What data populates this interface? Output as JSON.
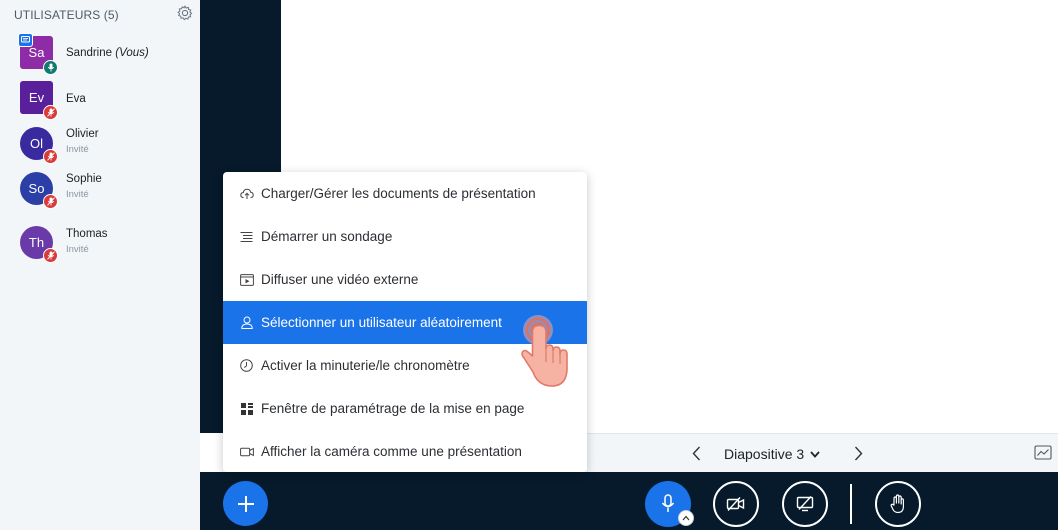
{
  "sidebar": {
    "header": "UTILISATEURS (5)",
    "gear_icon": "gear-icon",
    "users": [
      {
        "initials": "Sa",
        "name": "Sandrine",
        "suffix": "(Vous)",
        "subtitle": "",
        "color": "#8e2ca8",
        "shape": "square",
        "badge": "mic",
        "badge_color": "#12796f"
      },
      {
        "initials": "Ev",
        "name": "Eva",
        "suffix": "",
        "subtitle": "",
        "color": "#5a1f9b",
        "shape": "square",
        "badge": "mic-muted",
        "badge_color": "#d93a3a"
      },
      {
        "initials": "Ol",
        "name": "Olivier",
        "suffix": "",
        "subtitle": "Invité",
        "color": "#3a2aa0",
        "shape": "circle",
        "badge": "mic-muted",
        "badge_color": "#d93a3a"
      },
      {
        "initials": "So",
        "name": "Sophie",
        "suffix": "",
        "subtitle": "Invité",
        "color": "#2b3fa6",
        "shape": "circle",
        "badge": "mic-muted",
        "badge_color": "#d93a3a"
      },
      {
        "initials": "Th",
        "name": "Thomas",
        "suffix": "",
        "subtitle": "Invité",
        "color": "#6a3aa8",
        "shape": "circle",
        "badge": "mic-muted",
        "badge_color": "#d93a3a"
      }
    ]
  },
  "menu": {
    "items": [
      {
        "label": "Charger/Gérer les documents de présentation",
        "icon": "upload-cloud-icon",
        "active": false
      },
      {
        "label": "Démarrer un sondage",
        "icon": "poll-list-icon",
        "active": false
      },
      {
        "label": "Diffuser une vidéo externe",
        "icon": "external-video-icon",
        "active": false
      },
      {
        "label": "Sélectionner un utilisateur aléatoirement",
        "icon": "user-icon",
        "active": true
      },
      {
        "label": "Activer la minuterie/le chronomètre",
        "icon": "clock-icon",
        "active": false
      },
      {
        "label": "Fenêtre de paramétrage de la mise en page",
        "icon": "layout-grid-icon",
        "active": false
      },
      {
        "label": "Afficher la caméra comme une présentation",
        "icon": "camera-icon",
        "active": false
      }
    ]
  },
  "slide_nav": {
    "label": "Diapositive 3"
  },
  "colors": {
    "accent": "#1a73e8",
    "dark": "#061a2b",
    "sidebar_bg": "#f3f6f9",
    "muted_red": "#d93a3a"
  }
}
